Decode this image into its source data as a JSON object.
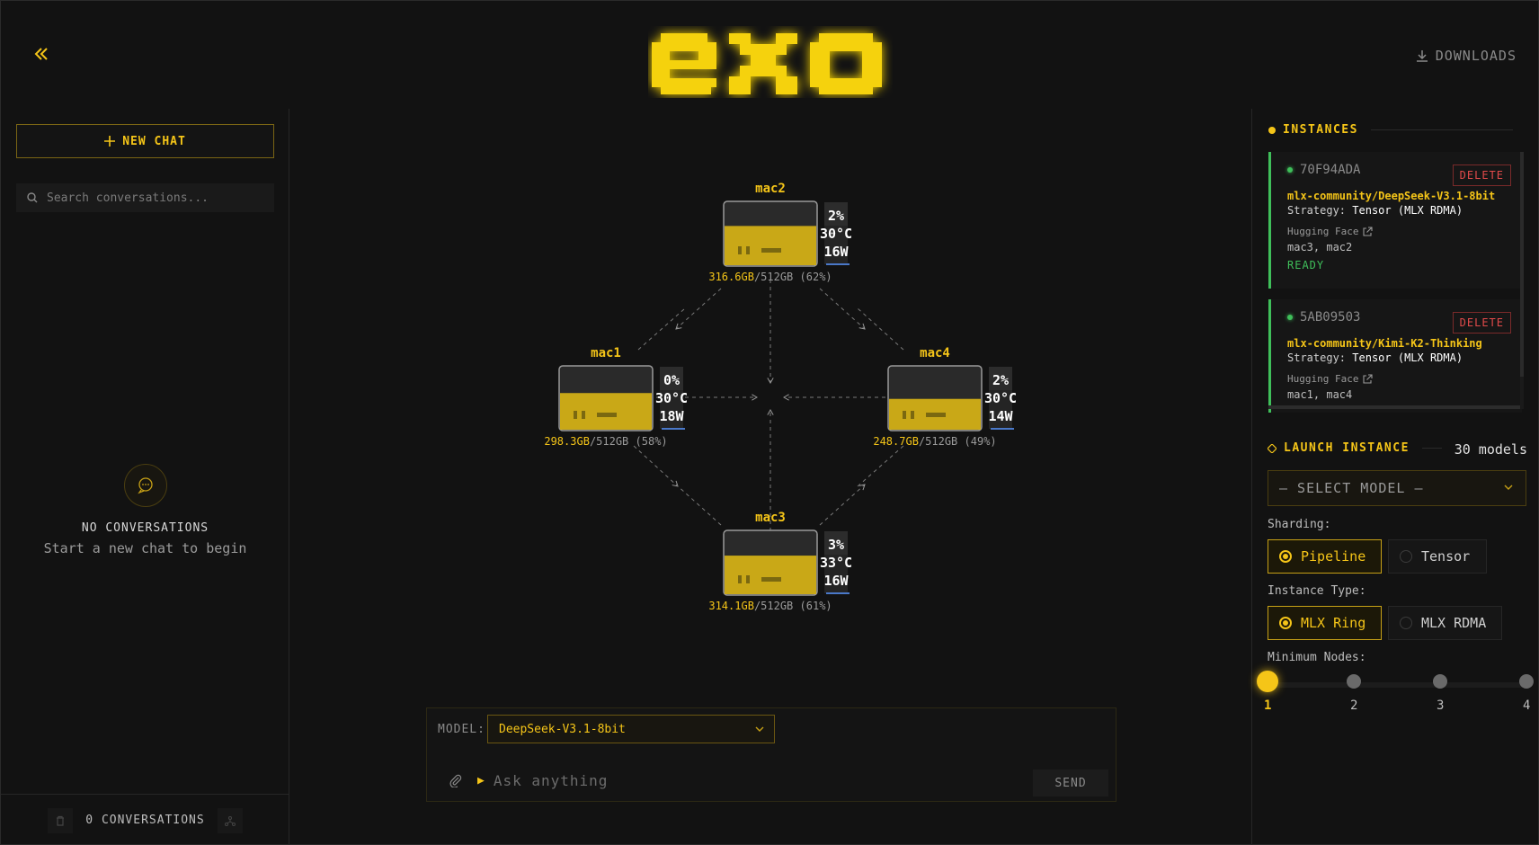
{
  "header": {
    "logo_text": "exo",
    "downloads_label": "DOWNLOADS"
  },
  "sidebar": {
    "new_chat_label": "NEW CHAT",
    "search_placeholder": "Search conversations...",
    "empty_title": "NO CONVERSATIONS",
    "empty_subtitle": "Start a new chat to begin",
    "conversation_count": "0 CONVERSATIONS"
  },
  "topology": {
    "nodes": [
      {
        "name": "mac2",
        "mem_used": "316.6GB",
        "mem_total": "/512GB",
        "mem_pct": "(62%)",
        "gpu": "2%",
        "temp": "30°C",
        "power": "16W",
        "fill": 0.62
      },
      {
        "name": "mac1",
        "mem_used": "298.3GB",
        "mem_total": "/512GB",
        "mem_pct": "(58%)",
        "gpu": "0%",
        "temp": "30°C",
        "power": "18W",
        "fill": 0.58
      },
      {
        "name": "mac4",
        "mem_used": "248.7GB",
        "mem_total": "/512GB",
        "mem_pct": "(49%)",
        "gpu": "2%",
        "temp": "30°C",
        "power": "14W",
        "fill": 0.49
      },
      {
        "name": "mac3",
        "mem_used": "314.1GB",
        "mem_total": "/512GB",
        "mem_pct": "(61%)",
        "gpu": "3%",
        "temp": "33°C",
        "power": "16W",
        "fill": 0.61
      }
    ]
  },
  "chat": {
    "model_label": "MODEL:",
    "model_value": "DeepSeek-V3.1-8bit",
    "input_placeholder": "Ask anything",
    "send_label": "SEND"
  },
  "instances": {
    "title": "INSTANCES",
    "items": [
      {
        "id": "70F94ADA",
        "delete_label": "DELETE",
        "model": "mlx-community/DeepSeek-V3.1-8bit",
        "strategy_label": "Strategy:",
        "strategy": "Tensor (MLX RDMA)",
        "hf_label": "Hugging Face",
        "nodes": "mac3, mac2",
        "status": "READY"
      },
      {
        "id": "5AB09503",
        "delete_label": "DELETE",
        "model": "mlx-community/Kimi-K2-Thinking",
        "strategy_label": "Strategy:",
        "strategy": "Tensor (MLX RDMA)",
        "hf_label": "Hugging Face",
        "nodes": "mac1, mac4",
        "status": ""
      }
    ]
  },
  "launch": {
    "title": "LAUNCH INSTANCE",
    "models_count": "30 models",
    "select_placeholder": "— SELECT MODEL —",
    "sharding_label": "Sharding:",
    "sharding_options": [
      "Pipeline",
      "Tensor"
    ],
    "sharding_selected": "Pipeline",
    "instance_type_label": "Instance Type:",
    "instance_type_options": [
      "MLX Ring",
      "MLX RDMA"
    ],
    "instance_type_selected": "MLX Ring",
    "min_nodes_label": "Minimum Nodes:",
    "min_nodes_ticks": [
      "1",
      "2",
      "3",
      "4"
    ],
    "min_nodes_value": 1
  },
  "colors": {
    "accent": "#f5c518",
    "ready": "#3fbf5a",
    "danger": "#e04a4a",
    "background": "#121212"
  }
}
